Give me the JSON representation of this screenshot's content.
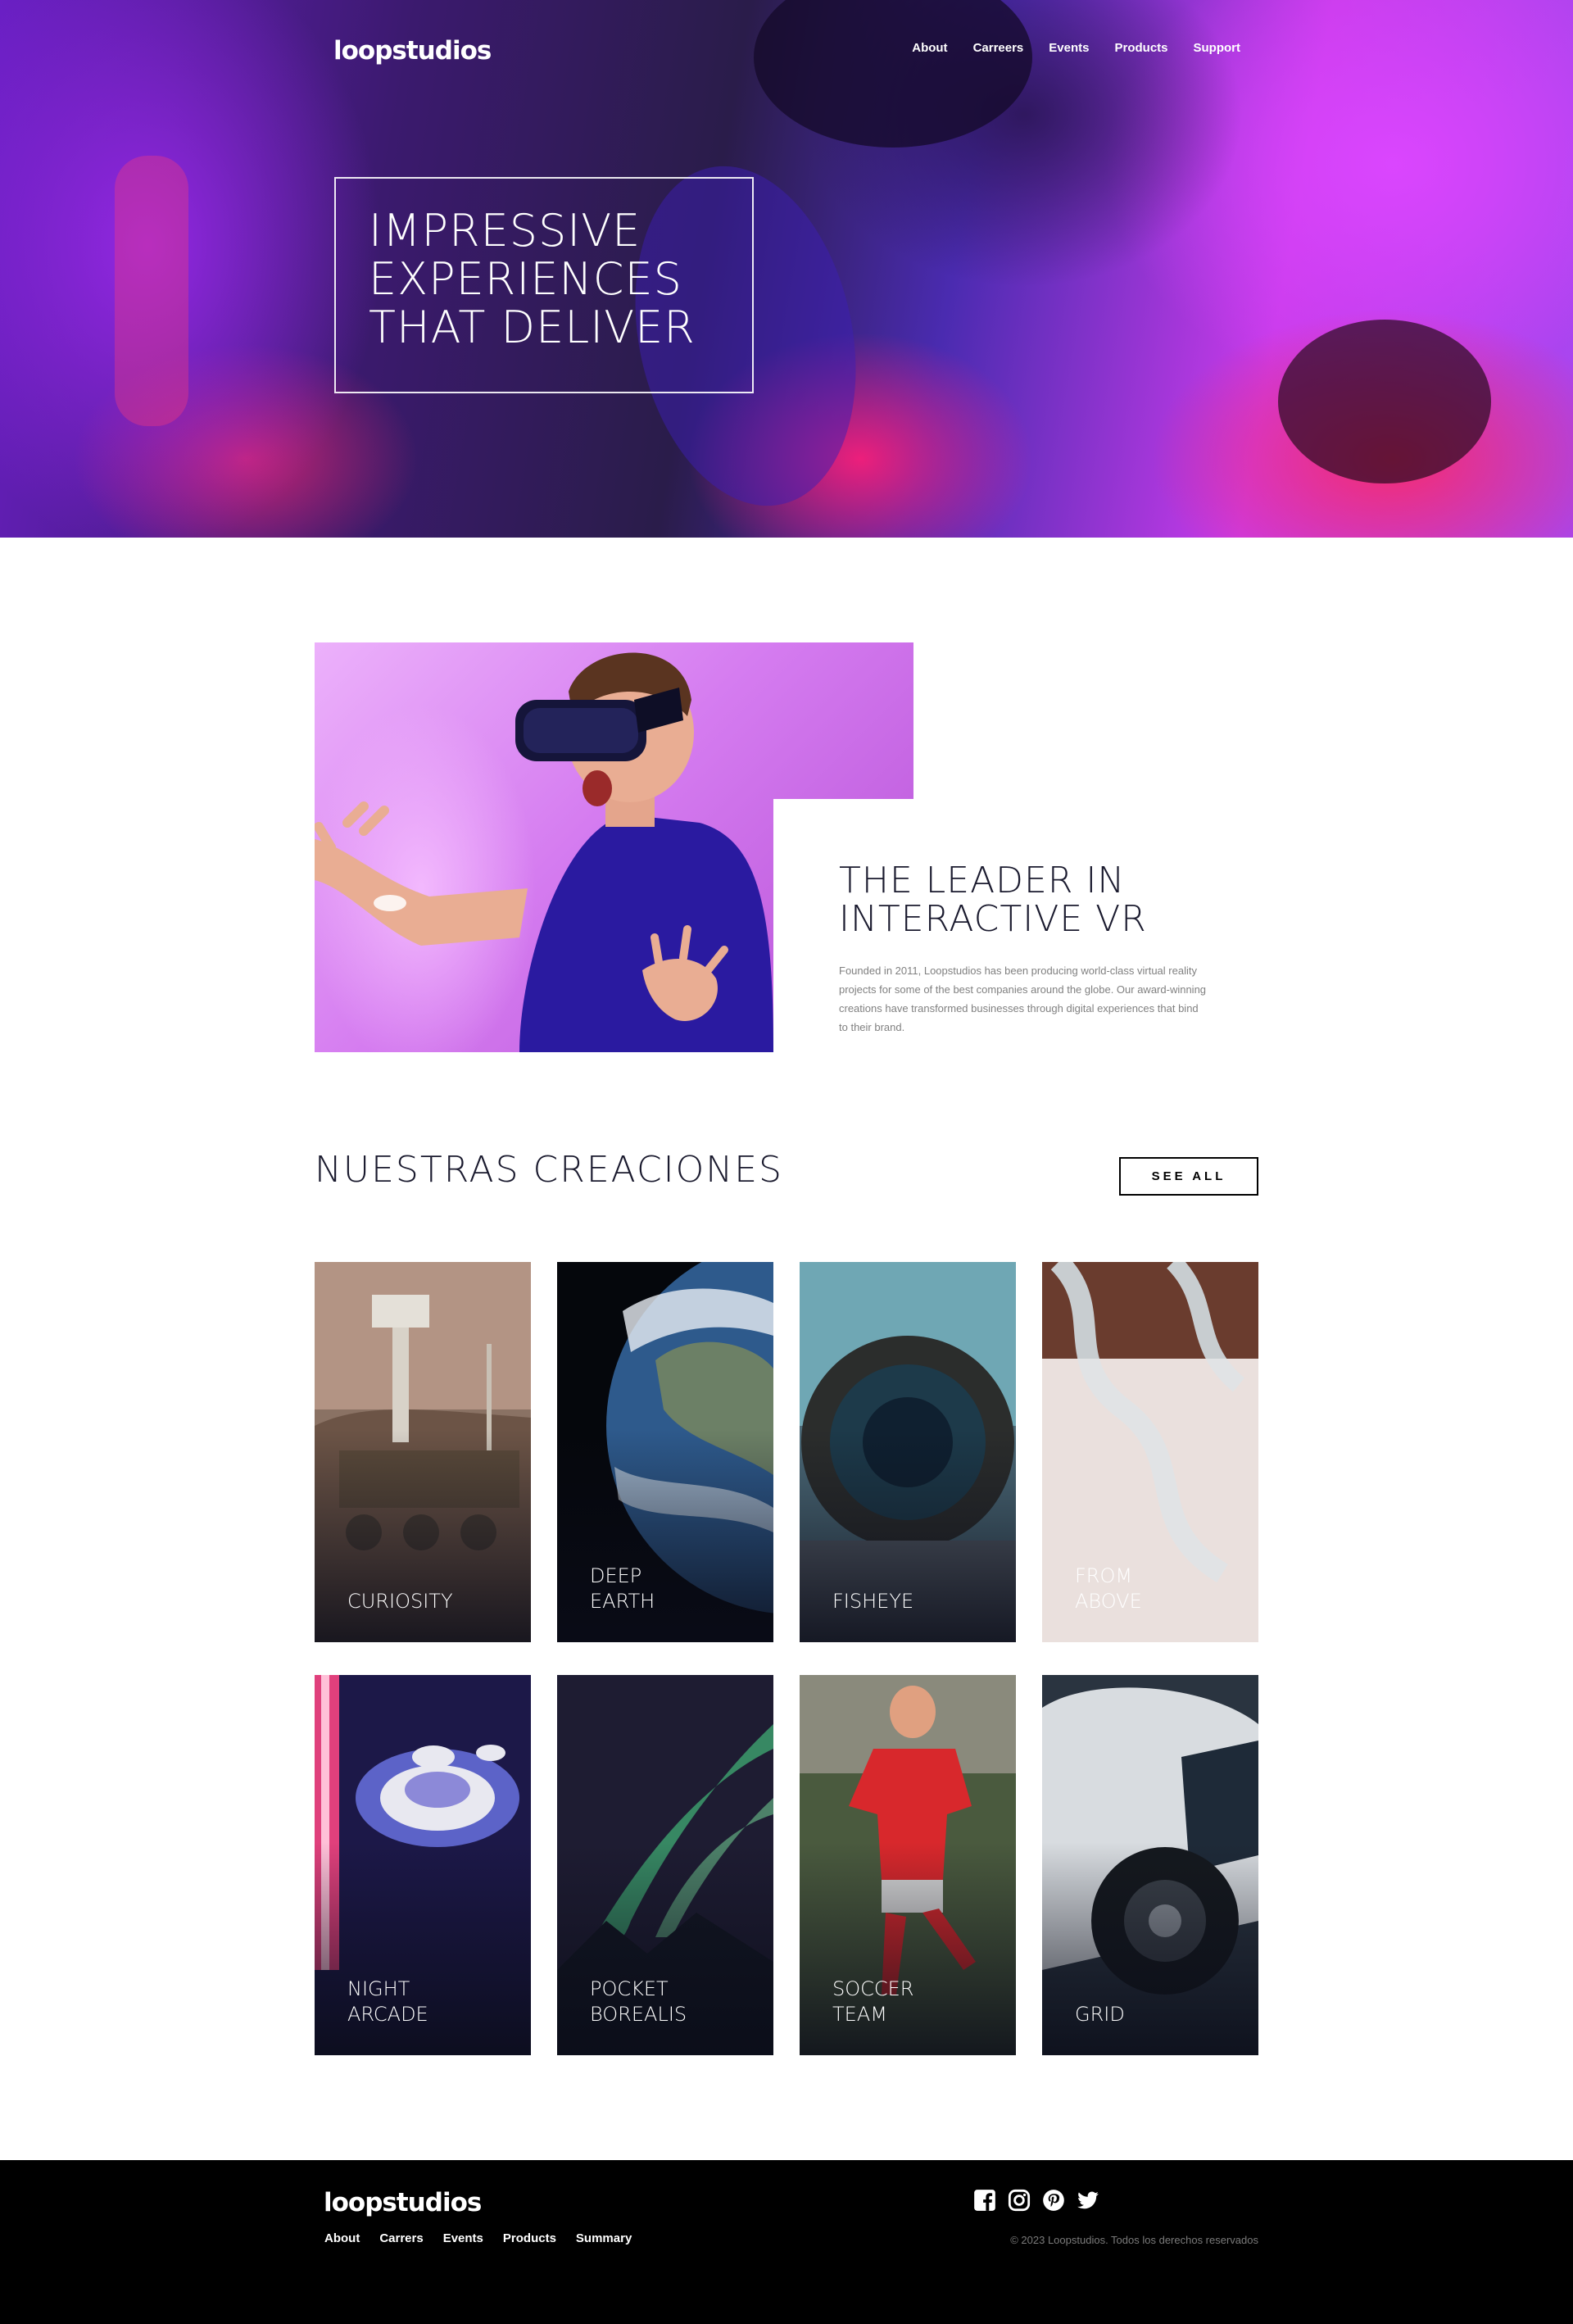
{
  "header": {
    "logo": "loopstudios",
    "nav": [
      "About",
      "Carreers",
      "Events",
      "Products",
      "Support"
    ]
  },
  "hero": {
    "title_lines": [
      "IMPRESSIVE",
      "EXPERIENCES",
      "THAT DELIVER"
    ]
  },
  "intro": {
    "title": "THE LEADER IN\nINTERACTIVE VR",
    "text": "Founded in 2011, Loopstudios has been producing world-class virtual reality projects for some of the best companies around the globe. Our award-winning creations have transformed businesses through digital experiences that bind to their brand."
  },
  "creations": {
    "heading": "NUESTRAS CREACIONES",
    "see_all_label": "SEE ALL",
    "items": [
      {
        "label": "CURIOSITY"
      },
      {
        "label": "DEEP\nEARTH"
      },
      {
        "label": "FISHEYE"
      },
      {
        "label": "FROM\nABOVE"
      },
      {
        "label": "NIGHT\nARCADE"
      },
      {
        "label": "POCKET\nBOREALIS"
      },
      {
        "label": "SOCCER\nTEAM"
      },
      {
        "label": "GRID"
      }
    ]
  },
  "footer": {
    "logo": "loopstudios",
    "nav": [
      "About",
      "Carrers",
      "Events",
      "Products",
      "Summary"
    ],
    "socials": [
      "facebook-icon",
      "instagram-icon",
      "pinterest-icon",
      "twitter-icon"
    ],
    "copyright": "© 2023 Loopstudios. Todos los derechos reservados"
  }
}
